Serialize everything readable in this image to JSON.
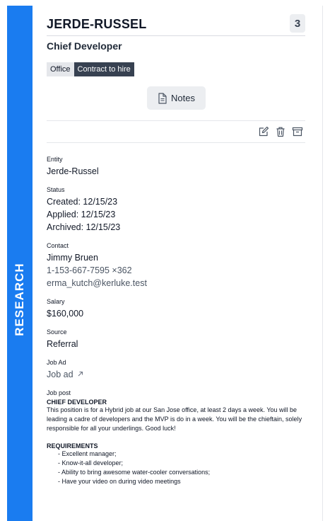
{
  "sidebar": {
    "label": "RESEARCH",
    "color": "#1a7cf0"
  },
  "header": {
    "company": "JERDE-RUSSEL",
    "count": "3"
  },
  "job_title": "Chief Developer",
  "tags": {
    "location": "Office",
    "type": "Contract to hire"
  },
  "notes_button": {
    "label": "Notes",
    "icon": "document-icon"
  },
  "actions": {
    "icons": [
      "edit-icon",
      "trash-icon",
      "archive-icon"
    ]
  },
  "details": {
    "entity": {
      "label": "Entity",
      "value": "Jerde-Russel"
    },
    "status": {
      "label": "Status",
      "created": "Created: 12/15/23",
      "applied": "Applied: 12/15/23",
      "archived": "Archived: 12/15/23"
    },
    "contact": {
      "label": "Contact",
      "name": "Jimmy Bruen",
      "phone": "1-153-667-7595 ×362",
      "email": "erma_kutch@kerluke.test"
    },
    "salary": {
      "label": "Salary",
      "value": "$160,000"
    },
    "source": {
      "label": "Source",
      "value": "Referral"
    },
    "job_ad": {
      "label": "Job Ad",
      "link": "Job ad",
      "icon": "external-link-icon"
    },
    "job_post": {
      "label": "Job post",
      "heading": "CHIEF DEVELOPER",
      "body": "This position is for a Hybrid job at our San Jose office, at least 2 days a week. You will be leading a cadre of developers and the MVP is do in a week. You will be the chieftain, solely responsible for all your underlings. Good luck!",
      "req_heading": "REQUIREMENTS",
      "requirements": [
        "Excellent manager;",
        "Know-it-all developer;",
        "Ability to bring awesome water-cooler conversations;",
        "Have your video on during video meetings"
      ]
    }
  }
}
